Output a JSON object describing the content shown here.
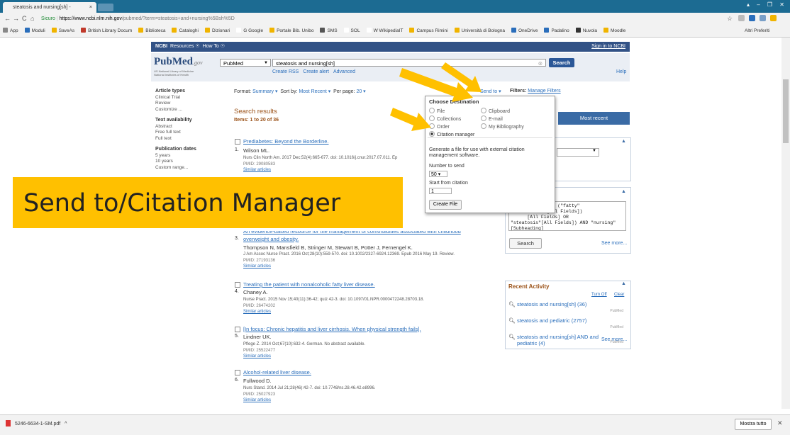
{
  "browser": {
    "tab_title": "steatosis and nursing[sh] - ",
    "tab_close": "×",
    "window_controls": "▴ – ❐ ✕",
    "secure_label": "Sicuro",
    "url_host": "https://www.ncbi.nlm.nih.gov",
    "url_path": "/pubmed/?term=steatosis+and+nursing%5Bsh%5D",
    "nav_back": "←",
    "nav_forward": "→",
    "nav_reload": "C",
    "nav_home": "⌂",
    "star": "☆",
    "bookmarks": [
      {
        "label": "App",
        "color": "#888"
      },
      {
        "label": "Moduli",
        "color": "#2a6ebb"
      },
      {
        "label": "SaveAs",
        "color": "#f0b400"
      },
      {
        "label": "British Library Docum",
        "color": "#c0392b"
      },
      {
        "label": "Biblioteca",
        "color": "#f0b400"
      },
      {
        "label": "Cataloghi",
        "color": "#f0b400"
      },
      {
        "label": "Dizionari",
        "color": "#f0b400"
      },
      {
        "label": "G Google",
        "color": "#fff"
      },
      {
        "label": "Portale Bib. Unibo",
        "color": "#f0b400"
      },
      {
        "label": "SMS",
        "color": "#555"
      },
      {
        "label": "SOL",
        "color": "#fff"
      },
      {
        "label": "W WikipediaIT",
        "color": "#fff"
      },
      {
        "label": "Campus Rimini",
        "color": "#f0b400"
      },
      {
        "label": "Università di Bologna",
        "color": "#f0b400"
      },
      {
        "label": "OneDrive",
        "color": "#2a6ebb"
      },
      {
        "label": "Padalino",
        "color": "#2a6ebb"
      },
      {
        "label": "Nuvola",
        "color": "#333"
      },
      {
        "label": "Moodle",
        "color": "#f0b400"
      }
    ],
    "other_bookmarks": "Altri Preferiti"
  },
  "ncbi": {
    "brand": "NCBI",
    "resources": "Resources ☉",
    "howto": "How To ☉",
    "signin": "Sign in to NCBI"
  },
  "pubmed": {
    "logo_main": "PubMed",
    "logo_gov": ".gov",
    "logo_sub": "US National Library of Medicine National Institutes of Health",
    "db": "PubMed",
    "query": "steatosis and nursing[sh]",
    "search_btn": "Search",
    "create_rss": "Create RSS",
    "create_alert": "Create alert",
    "advanced": "Advanced",
    "help": "Help"
  },
  "left_nav": [
    {
      "heading": "Article types",
      "items": [
        "Clinical Trial",
        "Review",
        "Customize ..."
      ]
    },
    {
      "heading": "Text availability",
      "items": [
        "Abstract",
        "Free full text",
        "Full text"
      ]
    },
    {
      "heading": "Publication dates",
      "items": [
        "5 years",
        "10 years",
        "Custom range..."
      ]
    }
  ],
  "toolbar": {
    "format_label": "Format:",
    "format_value": "Summary ▾",
    "sort_label": "Sort by:",
    "sort_value": "Most Recent ▾",
    "perpage_label": "Per page:",
    "perpage_value": "20 ▾",
    "send_to": "Send to ▾",
    "filters_label": "Filters:",
    "manage_filters": "Manage Filters"
  },
  "results": {
    "title": "Search results",
    "items": "Items: 1 to 20 of 36",
    "list": [
      {
        "num": "1.",
        "title": "Prediabetes: Beyond the Borderline.",
        "authors": "Wilson ML.",
        "citation": "Nurs Clin North Am. 2017 Dec;52(4):665-677. doi: 10.1016/j.cnur.2017.07.011. Ep",
        "pmid": "PMID: 29080583",
        "similar": "Similar articles"
      },
      {
        "num": "3.",
        "title": "An evidence-based resource for the management of comorbidities associated with childhood",
        "title2": "overweight and obesity.",
        "authors": "Thompson N, Mansfield B, Stringer M, Stewart B, Potter J, Fernengel K.",
        "citation": "J Am Assoc Nurse Pract. 2016 Oct;28(10):559-570. doi: 10.1002/2327-6924.12369. Epub 2016 May 19. Review.",
        "pmid": "PMID: 27193136",
        "similar": "Similar articles"
      },
      {
        "num": "4.",
        "title": "Treating the patient with nonalcoholic fatty liver disease.",
        "authors": "Chaney A.",
        "citation": "Nurse Pract. 2015 Nov 15;40(11):36-42; quiz 42-3. doi: 10.1097/01.NPR.0000472248.28703.18.",
        "pmid": "PMID: 26474202",
        "similar": "Similar articles"
      },
      {
        "num": "5.",
        "title": "[In focus: Chronic hepatitis and liver cirrhosis. When physical strength fails].",
        "authors": "Lindner UK.",
        "citation": "Pflege Z. 2014 Oct;67(10):632-4. German. No abstract available.",
        "pmid": "PMID: 25522477",
        "similar": "Similar articles"
      },
      {
        "num": "6.",
        "title": "Alcohol-related liver disease.",
        "authors": "Fullwood D.",
        "citation": "Nurs Stand. 2014 Jul 21;28(46):42-7. doi: 10.7748/ns.28.46.42.e8996.",
        "pmid": "PMID: 25027923",
        "similar": "Similar articles"
      }
    ]
  },
  "sidebar": {
    "most_recent": "Most recent",
    "search_details_text": "    SH Terms] OR (\"fatty\"\n      \"liver\"[All Fields])\n      [All Fields] OR\n\"steatosis\"[All Fields]) AND \"nursing\"\n[Subheading]",
    "search_btn": "Search",
    "see_more": "See more...",
    "recent_title": "Recent Activity",
    "turn_off": "Turn Off",
    "clear": "Clear",
    "recent_items": [
      {
        "text": "steatosis and nursing[sh] (36)",
        "tag": "PubMed"
      },
      {
        "text": "steatosis and pediatric (2757)",
        "tag": "PubMed"
      },
      {
        "text": "steatosis and nursing[sh] AND and pediatric (4)",
        "tag": "PubMed"
      }
    ],
    "see_more2": "See more..."
  },
  "send_popup": {
    "title": "Choose Destination",
    "options": [
      "File",
      "Clipboard",
      "Collections",
      "E-mail",
      "Order",
      "My Bibliography",
      "Citation manager"
    ],
    "selected": "Citation manager",
    "desc": "Generate a file for use with external citation management software.",
    "number_label": "Number to send",
    "number_value": "50 ▾",
    "start_label": "Start from citation",
    "start_value": "1",
    "create_btn": "Create File"
  },
  "banner_text": "Send to/Citation Manager",
  "download": {
    "file": "5246-6634-1-SM.pdf",
    "caret": "^",
    "show_all": "Mostra tutto",
    "close": "✕"
  },
  "colors": {
    "arrow": "#ffc000",
    "banner": "#ffc000",
    "ncbi_bar": "#325286",
    "link": "#2a6ebb"
  }
}
